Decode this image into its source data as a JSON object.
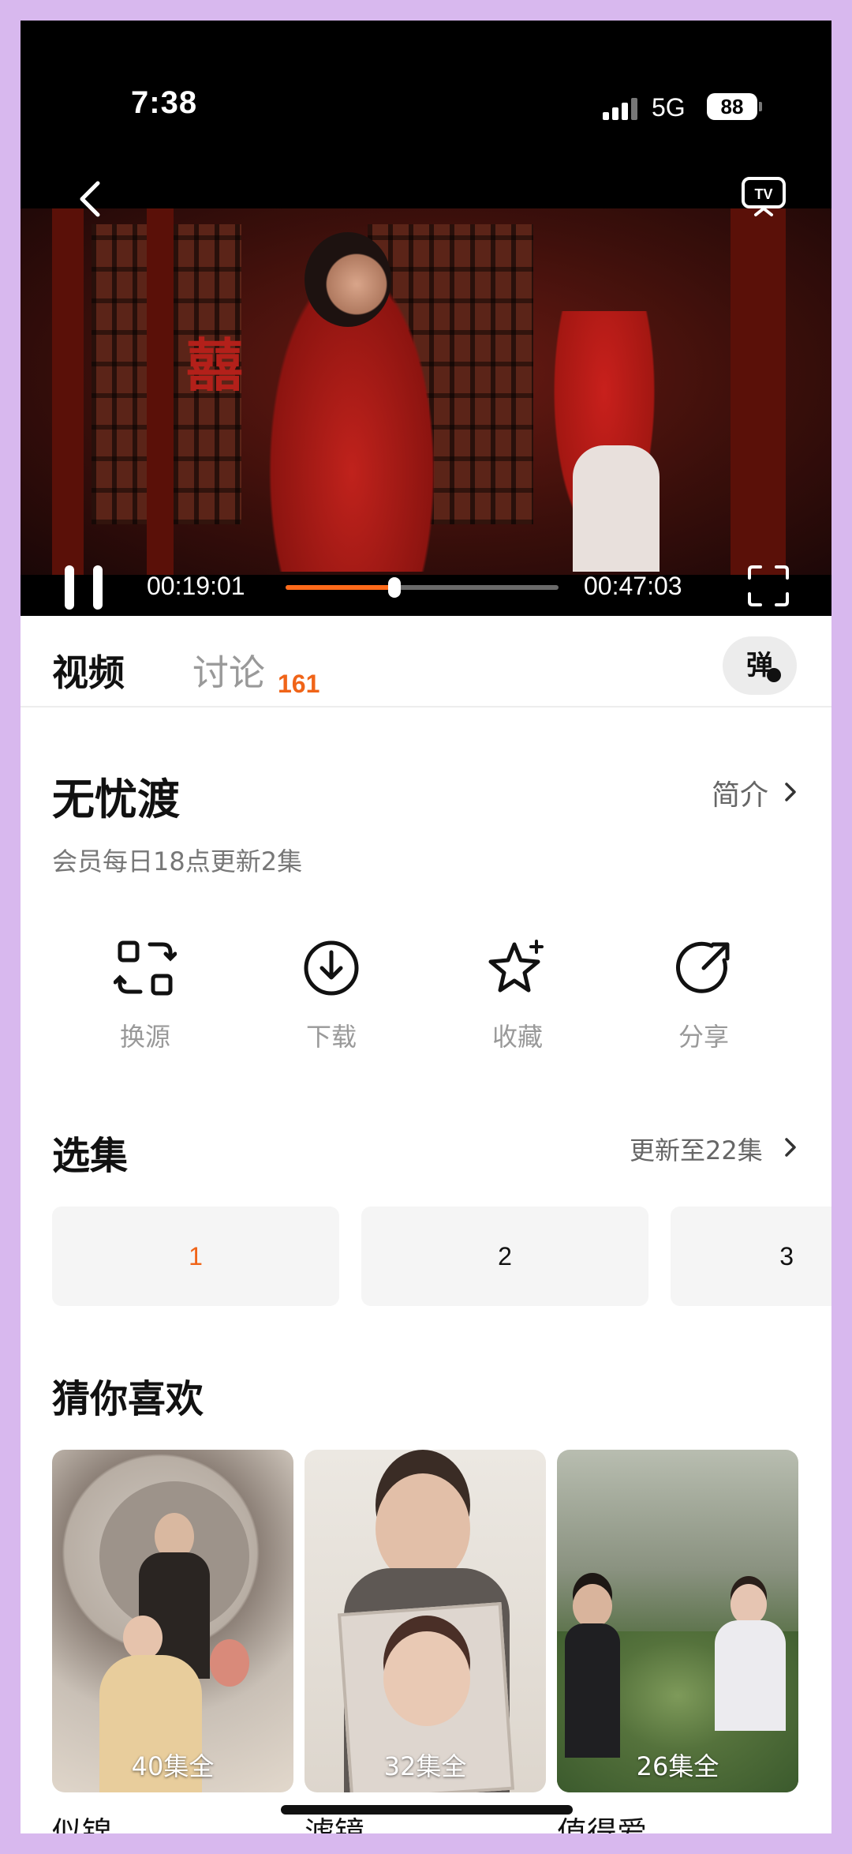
{
  "status_bar": {
    "time": "7:38",
    "network": "5G",
    "battery": "88"
  },
  "player": {
    "current_time": "00:19:01",
    "total_time": "00:47:03",
    "progress_fraction": 0.4
  },
  "tabs": {
    "video_label": "视频",
    "discuss_label": "讨论",
    "discuss_count": "161",
    "danmaku_label": "弹"
  },
  "show": {
    "title": "无忧渡",
    "intro_label": "简介",
    "update_note": "会员每日18点更新2集"
  },
  "actions": [
    {
      "label": "换源",
      "icon": "switch-source-icon"
    },
    {
      "label": "下载",
      "icon": "download-icon"
    },
    {
      "label": "收藏",
      "icon": "favorite-star-icon"
    },
    {
      "label": "分享",
      "icon": "share-icon"
    }
  ],
  "episodes": {
    "title": "选集",
    "more_label": "更新至22集",
    "items": [
      "1",
      "2",
      "3"
    ],
    "active_index": 0
  },
  "recommend": {
    "title": "猜你喜欢",
    "items": [
      {
        "name": "似锦",
        "badge": "40集全"
      },
      {
        "name": "滤镜",
        "badge": "32集全"
      },
      {
        "name": "值得爱",
        "badge": "26集全"
      }
    ]
  },
  "colors": {
    "accent": "#f06418",
    "progress": "#ff6a1a",
    "frame": "#d8b8ee"
  }
}
